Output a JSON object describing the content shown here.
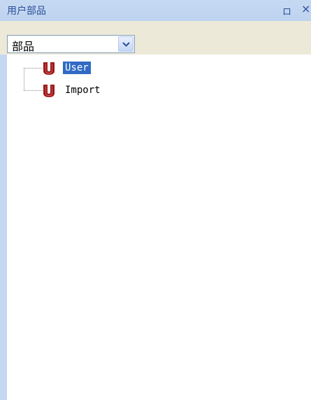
{
  "panel": {
    "title": "用户部品",
    "pin_glyph": "ロ",
    "close_glyph": "×"
  },
  "combo": {
    "selected": "部品",
    "arrow_icon": "chevron-down-icon"
  },
  "tree": {
    "items": [
      {
        "label": "User",
        "icon": "user-part-icon",
        "selected": true
      },
      {
        "label": "Import",
        "icon": "user-part-icon",
        "selected": false
      }
    ]
  },
  "colors": {
    "title_bg": "#c6d9f3",
    "title_text": "#2b4f9a",
    "toolbar_bg": "#ece9d8",
    "selection": "#316ac5",
    "icon_red": "#9b1b1b"
  }
}
